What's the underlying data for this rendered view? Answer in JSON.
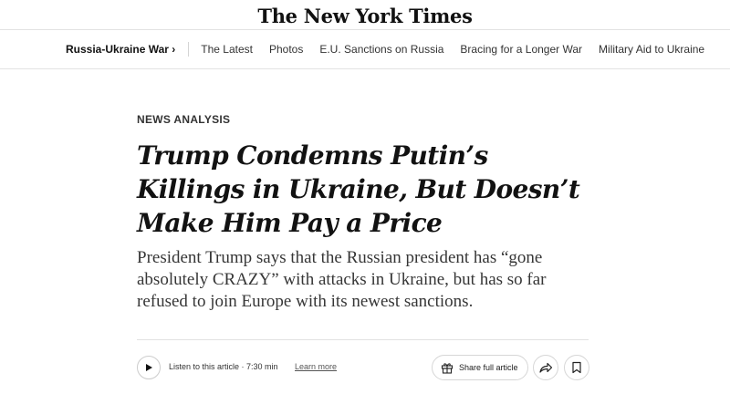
{
  "masthead": {
    "logo": "The New York Times"
  },
  "nav": {
    "section": "Russia-Ukraine War",
    "section_chevron": "›",
    "links": [
      "The Latest",
      "Photos",
      "E.U. Sanctions on Russia",
      "Bracing for a Longer War",
      "Military Aid to Ukraine"
    ]
  },
  "article": {
    "kicker": "NEWS ANALYSIS",
    "headline": "Trump Condemns Putin’s Killings in Ukraine, But Doesn’t Make Him Pay a Price",
    "summary": "President Trump says that the Russian president has “gone absolutely CRAZY” with attacks in Ukraine, but has so far refused to join Europe with its newest sanctions."
  },
  "toolbar": {
    "listen_label": "Listen to this article · 7:30 min",
    "learn_more": "Learn more",
    "share_label": "Share full article",
    "icons": {
      "play": "play-icon",
      "gift": "gift-icon",
      "forward": "share-arrow-icon",
      "bookmark": "bookmark-icon"
    }
  }
}
